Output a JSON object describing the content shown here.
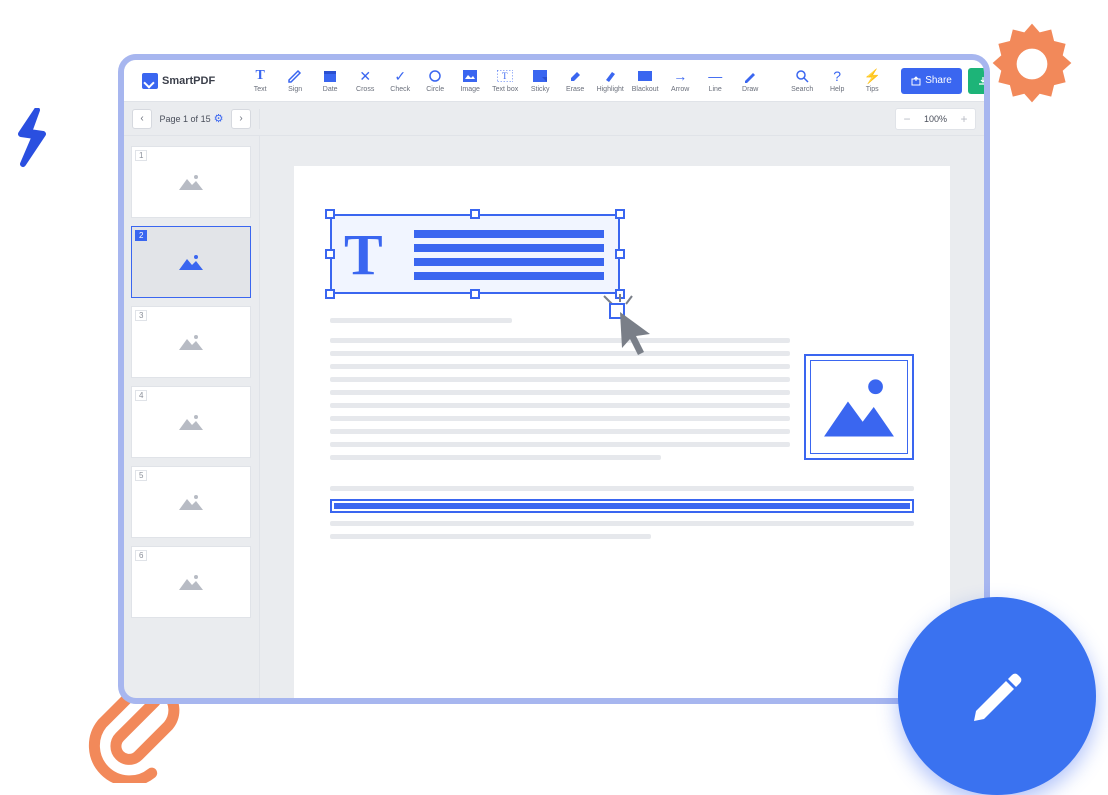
{
  "app": {
    "name": "SmartPDF"
  },
  "tools": {
    "text": "Text",
    "sign": "Sign",
    "date": "Date",
    "cross": "Cross",
    "check": "Check",
    "circle": "Circle",
    "image": "Image",
    "textbox": "Text box",
    "sticky": "Sticky",
    "erase": "Erase",
    "highlight": "Highlight",
    "blackout": "Blackout",
    "arrow": "Arrow",
    "line": "Line",
    "draw": "Draw",
    "search": "Search",
    "help": "Help",
    "tips": "Tips"
  },
  "actions": {
    "share": "Share",
    "download": "Download pdf"
  },
  "pager": {
    "label": "Page 1 of 15"
  },
  "zoom": {
    "value": "100%"
  },
  "thumbs": [
    {
      "n": "1"
    },
    {
      "n": "2"
    },
    {
      "n": "3"
    },
    {
      "n": "4"
    },
    {
      "n": "5"
    },
    {
      "n": "6"
    }
  ],
  "selected_thumb": 1,
  "textbox_letter": "T"
}
